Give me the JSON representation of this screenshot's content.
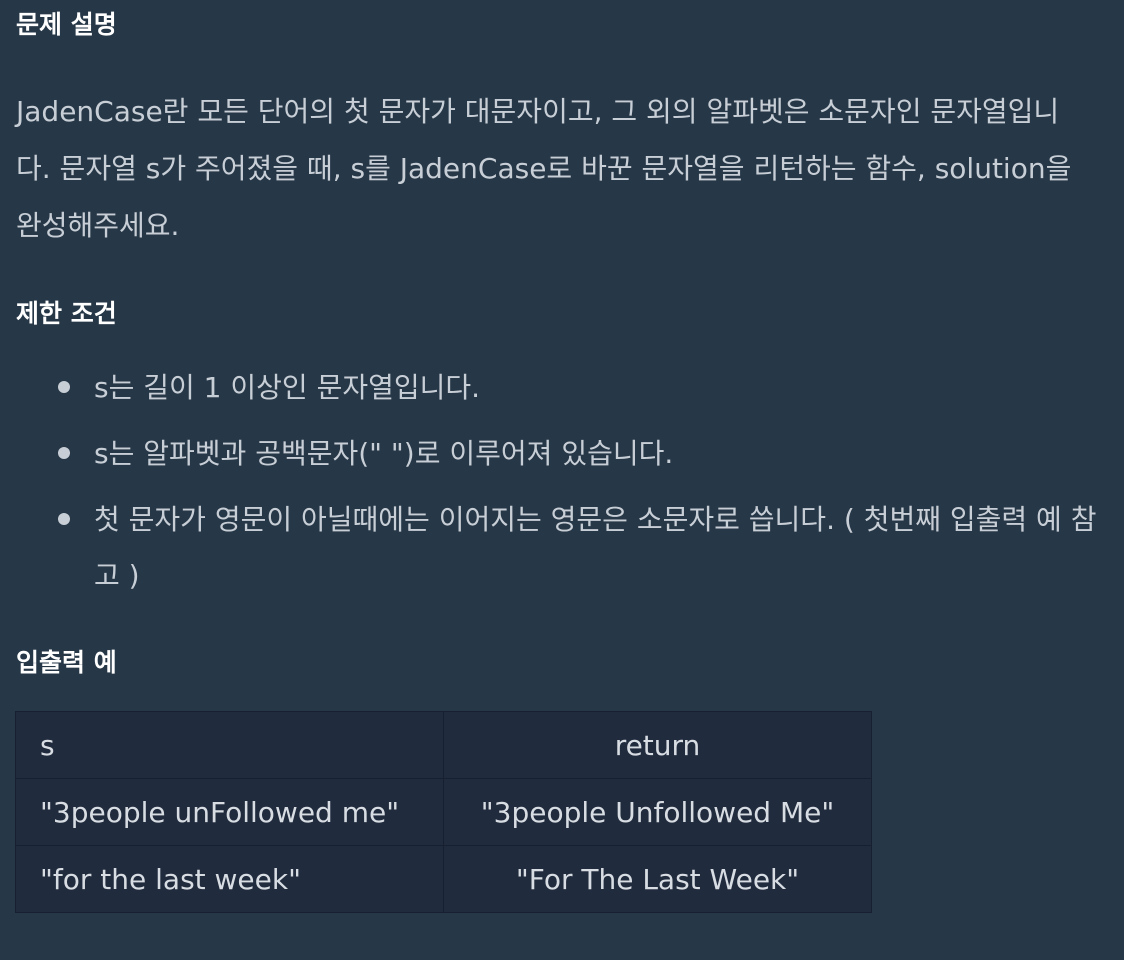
{
  "description": {
    "heading": "문제 설명",
    "text": "JadenCase란 모든 단어의 첫 문자가 대문자이고, 그 외의 알파벳은 소문자인 문자열입니다. 문자열 s가 주어졌을 때, s를 JadenCase로 바꾼 문자열을 리턴하는 함수, solution을 완성해주세요."
  },
  "constraints": {
    "heading": "제한 조건",
    "items": [
      "s는 길이 1 이상인 문자열입니다.",
      "s는 알파벳과 공백문자(\" \")로 이루어져 있습니다.",
      "첫 문자가 영문이 아닐때에는 이어지는 영문은 소문자로 씁니다. ( 첫번째 입출력 예 참고 )"
    ]
  },
  "examples": {
    "heading": "입출력 예",
    "columns": [
      "s",
      "return"
    ],
    "rows": [
      [
        "\"3people unFollowed me\"",
        "\"3people Unfollowed Me\""
      ],
      [
        "\"for the last week\"",
        "\"For The Last Week\""
      ]
    ]
  }
}
